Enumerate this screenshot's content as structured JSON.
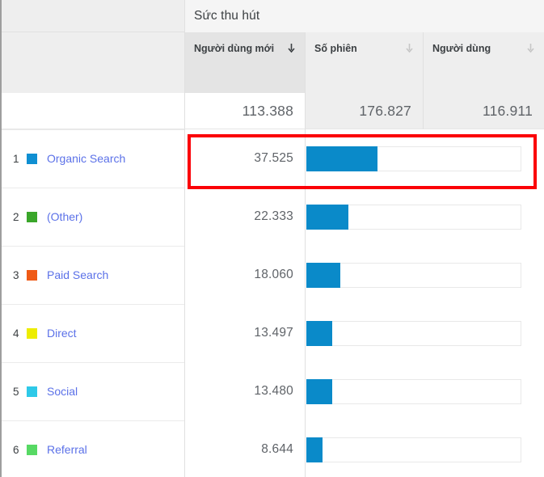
{
  "group": {
    "title": "Sức thu hút"
  },
  "columns": [
    {
      "label": "Người dùng mới",
      "sort_icon": "sort-descending-icon",
      "sorted": true,
      "total": "113.388"
    },
    {
      "label": "Số phiên",
      "sort_icon": "sort-descending-icon",
      "sorted": false,
      "total": "176.827"
    },
    {
      "label": "Người dùng",
      "sort_icon": "sort-descending-icon",
      "sorted": false,
      "total": "116.911"
    }
  ],
  "rows": [
    {
      "rank": "1",
      "label": "Organic Search",
      "swatch": "#0f8fd2",
      "value": "37.525",
      "bar_pct": 33.1,
      "highlighted": true
    },
    {
      "rank": "2",
      "label": "(Other)",
      "swatch": "#3aa62a",
      "value": "22.333",
      "bar_pct": 19.7,
      "highlighted": false
    },
    {
      "rank": "3",
      "label": "Paid Search",
      "swatch": "#ef5a16",
      "value": "18.060",
      "bar_pct": 15.9,
      "highlighted": false
    },
    {
      "rank": "4",
      "label": "Direct",
      "swatch": "#eded00",
      "value": "13.497",
      "bar_pct": 11.9,
      "highlighted": false
    },
    {
      "rank": "5",
      "label": "Social",
      "swatch": "#2ec9e8",
      "value": "13.480",
      "bar_pct": 11.9,
      "highlighted": false
    },
    {
      "rank": "6",
      "label": "Referral",
      "swatch": "#57d964",
      "value": "8.644",
      "bar_pct": 7.6,
      "highlighted": false
    }
  ],
  "annotation": {
    "type": "rectangle-highlight",
    "color": "#fb0007",
    "target_row": "Organic Search"
  },
  "colors": {
    "bar_fill": "#0a8ac9",
    "link": "#5b71e8",
    "header_bg": "#eeeeee",
    "value_text": "#5f6368",
    "annotation": "#fb0007"
  }
}
